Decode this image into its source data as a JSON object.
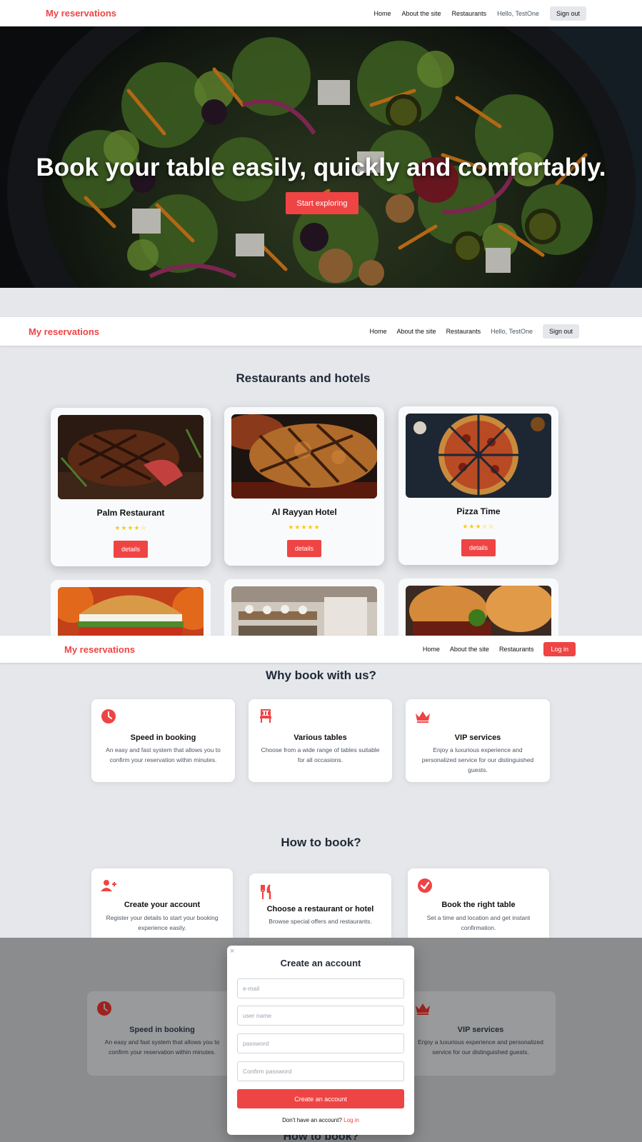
{
  "nav": {
    "brand": "My reservations",
    "home": "Home",
    "about": "About the site",
    "restaurants": "Restaurants",
    "greeting": "Hello, TestOne",
    "signout": "Sign out",
    "login": "Log in"
  },
  "hero": {
    "title": "Book your table easily, quickly and comfortably.",
    "cta": "Start exploring"
  },
  "restaurants_section": {
    "title": "Restaurants and hotels",
    "details_label": "details",
    "cards": [
      {
        "name": "Palm Restaurant",
        "rating": 4,
        "stars": "★★★★☆"
      },
      {
        "name": "Al Rayyan Hotel",
        "rating": 5,
        "stars": "★★★★★"
      },
      {
        "name": "Pizza Time",
        "rating": 3,
        "stars": "★★★☆☆"
      }
    ]
  },
  "why_section": {
    "title": "Why book with us?",
    "features": [
      {
        "icon": "clock-icon",
        "title": "Speed in booking",
        "desc": "An easy and fast system that allows you to confirm your reservation within minutes."
      },
      {
        "icon": "chair-icon",
        "title": "Various tables",
        "desc": "Choose from a wide range of tables suitable for all occasions."
      },
      {
        "icon": "crown-icon",
        "title": "VIP services",
        "desc": "Enjoy a luxurious experience and personalized service for our distinguished guests."
      }
    ]
  },
  "how_section": {
    "title": "How to book?",
    "steps": [
      {
        "icon": "user-plus-icon",
        "title": "Create your account",
        "desc": "Register your details to start your booking experience easily."
      },
      {
        "icon": "utensils-icon",
        "title": "Choose a restaurant or hotel",
        "desc": "Browse special offers and restaurants."
      },
      {
        "icon": "check-circle-icon",
        "title": "Book the right table",
        "desc": "Set a time and location and get instant confirmation."
      }
    ]
  },
  "modal": {
    "close": "×",
    "title": "Create an account",
    "email_placeholder": "e-mail",
    "username_placeholder": "user name",
    "password_placeholder": "password",
    "confirm_placeholder": "Confirm password",
    "submit": "Create an account",
    "footer_text": "Don't have an account?",
    "footer_link": "Log in"
  },
  "colors": {
    "accent": "#ef4444",
    "background": "#e5e7eb",
    "star": "#facc15"
  }
}
